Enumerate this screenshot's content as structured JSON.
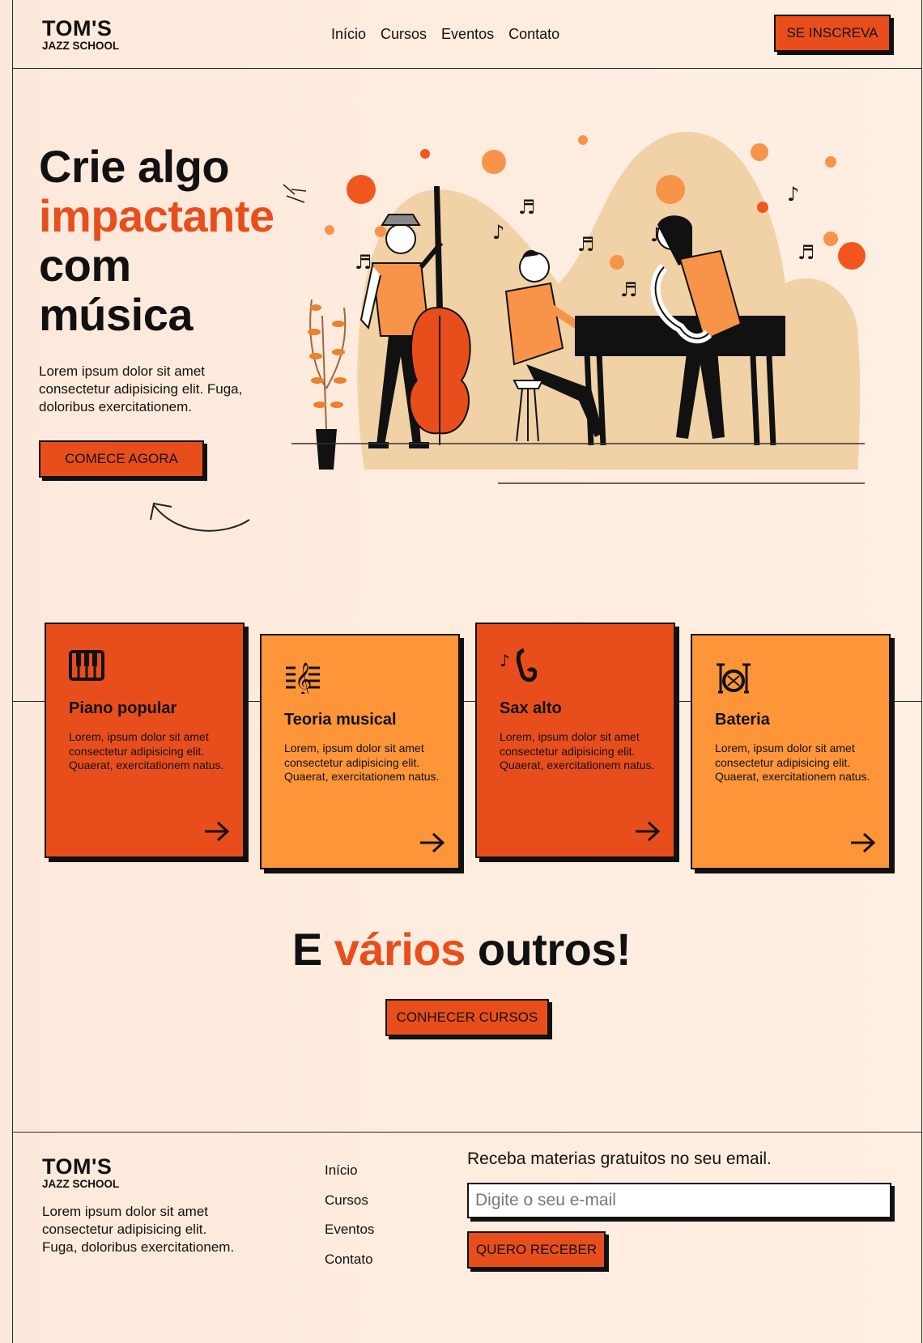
{
  "brand": {
    "name": "TOM'S",
    "sub": "JAZZ SCHOOL"
  },
  "nav": {
    "items": [
      "Início",
      "Cursos",
      "Eventos",
      "Contato"
    ],
    "cta": "SE INSCREVA"
  },
  "hero": {
    "title_line1": "Crie algo",
    "title_accent": "impactante",
    "title_line3": "com",
    "title_line4": "música",
    "text": "Lorem ipsum dolor sit amet consectetur adipisicing elit. Fuga, doloribus exercitationem.",
    "cta": "COMECE AGORA",
    "illustration": "jazz-band-illustration"
  },
  "courses": [
    {
      "title": "Piano popular",
      "text": "Lorem, ipsum dolor sit amet consectetur adipisicing elit. Quaerat, exercitationem natus.",
      "icon": "piano-icon",
      "color": "#e84e1b"
    },
    {
      "title": "Teoria musical",
      "text": "Lorem, ipsum dolor sit amet consectetur adipisicing elit. Quaerat, exercitationem natus.",
      "icon": "treble-clef-icon",
      "color": "#fe9538"
    },
    {
      "title": "Sax alto",
      "text": "Lorem, ipsum dolor sit amet consectetur adipisicing elit. Quaerat, exercitationem natus.",
      "icon": "saxophone-icon",
      "color": "#e84e1b"
    },
    {
      "title": "Bateria",
      "text": "Lorem, ipsum dolor sit amet consectetur adipisicing elit. Quaerat, exercitationem natus.",
      "icon": "drums-icon",
      "color": "#fe9538"
    }
  ],
  "others": {
    "pre": "E",
    "accent": "vários",
    "post": "outros!",
    "cta": "CONHECER CURSOS"
  },
  "footer": {
    "text": "Lorem ipsum dolor sit amet consectetur adipisicing elit. Fuga, doloribus exercitationem.",
    "nav": [
      "Início",
      "Cursos",
      "Eventos",
      "Contato"
    ],
    "newsletter_title": "Receba materias gratuitos no seu email.",
    "email_placeholder": "Digite o seu e-mail",
    "cta": "QUERO RECEBER"
  },
  "colors": {
    "accent": "#e84e1b",
    "accent_light": "#fe9538",
    "background": "#feefe2",
    "ink": "#111111"
  }
}
